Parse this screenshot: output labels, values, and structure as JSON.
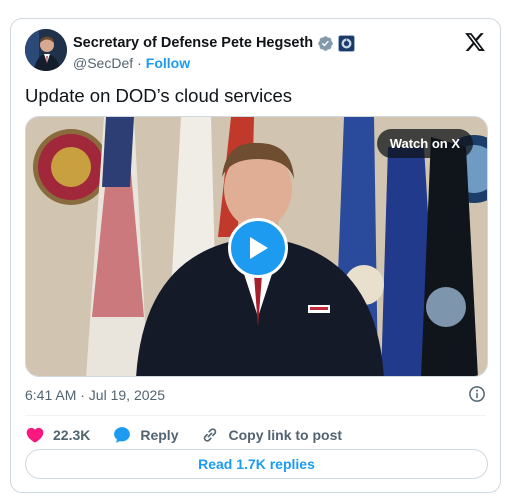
{
  "header": {
    "display_name": "Secretary of Defense Pete Hegseth",
    "handle": "@SecDef",
    "separator": "·",
    "follow_label": "Follow"
  },
  "tweet": {
    "text": "Update on DOD’s cloud services",
    "timestamp": "6:41 AM · Jul 19, 2025"
  },
  "media": {
    "watch_label": "Watch on X"
  },
  "actions": {
    "likes": "22.3K",
    "reply_label": "Reply",
    "copy_label": "Copy link to post"
  },
  "replies_button": "Read 1.7K replies",
  "colors": {
    "accent": "#1d9bf0",
    "like": "#f91880",
    "muted": "#536471",
    "verified_gray": "#829aab"
  },
  "icons": [
    "verified-badge-icon",
    "government-affiliation-icon",
    "x-logo-icon",
    "play-icon",
    "info-icon",
    "heart-icon",
    "reply-bubble-icon",
    "link-icon"
  ]
}
